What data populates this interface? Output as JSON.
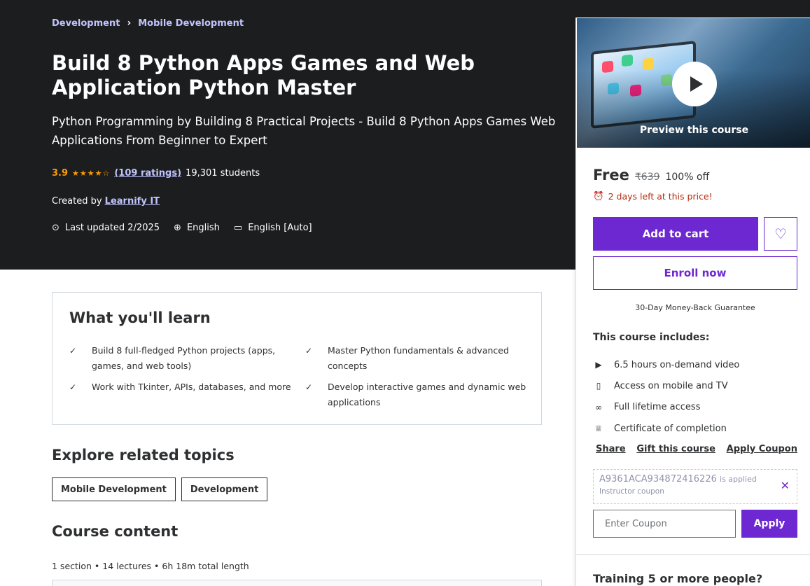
{
  "breadcrumb": [
    "Development",
    "Mobile Development"
  ],
  "course": {
    "title": "Build 8 Python Apps Games and Web Application Python Master",
    "subtitle": "Python Programming by Building 8 Practical Projects - Build 8 Python Apps Games Web Applications From Beginner to Expert",
    "rating": "3.9",
    "stars": "★★★★☆",
    "ratings_link": "(109 ratings)",
    "students": "19,301 students",
    "created_by_label": "Created by",
    "instructor": "Learnify IT",
    "last_updated": "Last updated 2/2025",
    "language": "English",
    "captions": "English [Auto]"
  },
  "sidebar": {
    "preview_label": "Preview this course",
    "price": "Free",
    "original_price": "₹639",
    "discount": "100% off",
    "deadline": "2 days left at this price!",
    "add_to_cart": "Add to cart",
    "enroll": "Enroll now",
    "guarantee": "30-Day Money-Back Guarantee",
    "includes_title": "This course includes:",
    "includes": [
      {
        "icon": "video-icon",
        "label": "6.5 hours on-demand video"
      },
      {
        "icon": "mobile-icon",
        "label": "Access on mobile and TV"
      },
      {
        "icon": "infinity-icon",
        "label": "Full lifetime access"
      },
      {
        "icon": "trophy-icon",
        "label": "Certificate of completion"
      }
    ],
    "actions": {
      "share": "Share",
      "gift": "Gift this course",
      "apply_coupon": "Apply Coupon"
    },
    "coupon": {
      "code": "A9361ACA934872416226",
      "applied_suffix": "is applied",
      "type": "Instructor coupon",
      "input_placeholder": "Enter Coupon",
      "apply_button": "Apply"
    },
    "training": "Training 5 or more people?"
  },
  "learn": {
    "title": "What you'll learn",
    "items": [
      "Build 8 full-fledged Python projects (apps, games, and web tools)",
      "Master Python fundamentals & advanced concepts",
      "Work with Tkinter, APIs, databases, and more",
      "Develop interactive games and dynamic web applications"
    ]
  },
  "related": {
    "title": "Explore related topics",
    "topics": [
      "Mobile Development",
      "Development"
    ]
  },
  "content": {
    "title": "Course content",
    "meta": "1 section • 14 lectures • 6h 18m total length"
  },
  "colors": {
    "hero_bg": "#1c1d1f",
    "accent": "#6d28d2",
    "link": "#c0c4fc",
    "star": "#f69c08",
    "alert": "#b32d0f"
  }
}
